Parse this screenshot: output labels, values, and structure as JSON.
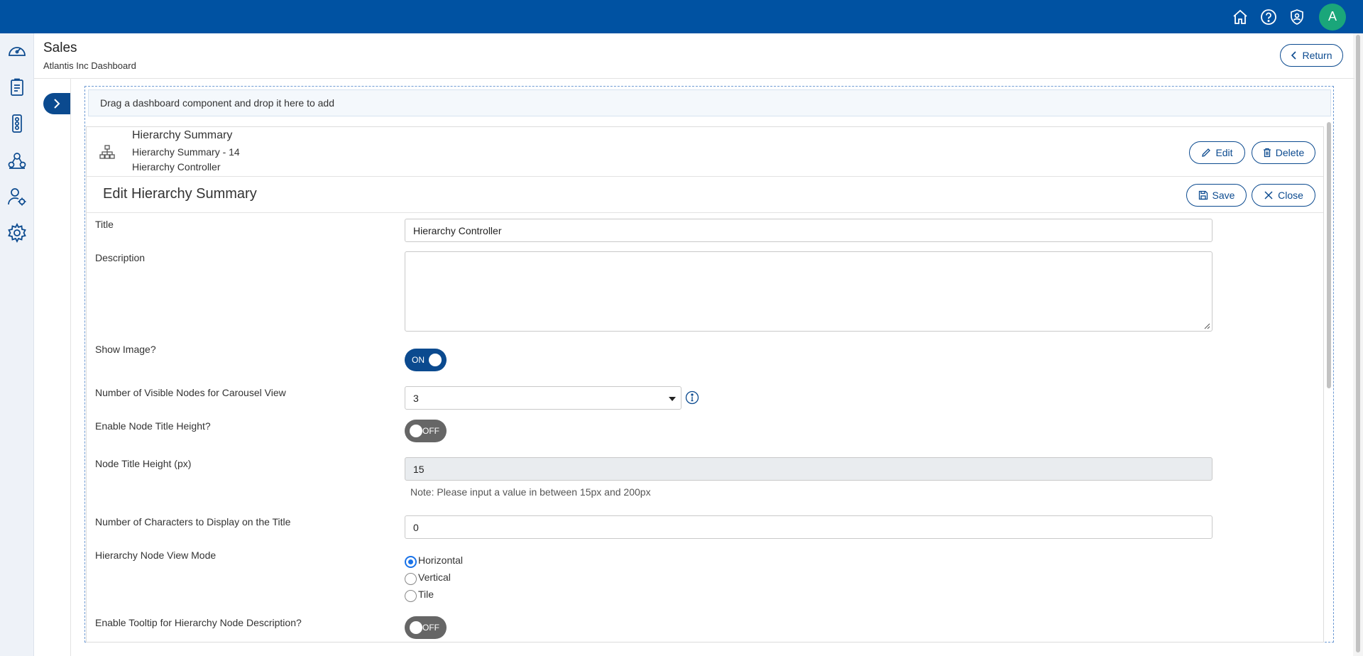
{
  "header": {
    "avatar_initial": "A",
    "icons": [
      "home-icon",
      "help-icon",
      "user-shield-icon"
    ]
  },
  "nav": {
    "icons": [
      "dashboard-gauge-icon",
      "document-icon",
      "traffic-light-icon",
      "network-icon",
      "user-settings-icon",
      "gear-icon"
    ]
  },
  "page": {
    "title": "Sales",
    "subtitle": "Atlantis Inc Dashboard",
    "return_label": "Return"
  },
  "dropzone": {
    "hint": "Drag a dashboard component and drop it here to add"
  },
  "component": {
    "name": "Hierarchy Summary",
    "id_label": "Hierarchy Summary - 14",
    "title": "Hierarchy Controller",
    "edit_label": "Edit",
    "delete_label": "Delete"
  },
  "editor": {
    "heading": "Edit Hierarchy Summary",
    "save_label": "Save",
    "close_label": "Close",
    "fields": {
      "title": {
        "label": "Title",
        "value": "Hierarchy Controller"
      },
      "description": {
        "label": "Description",
        "value": ""
      },
      "show_image": {
        "label": "Show Image?",
        "state": "ON"
      },
      "visible_nodes": {
        "label": "Number of Visible Nodes for Carousel View",
        "value": "3"
      },
      "enable_title_height": {
        "label": "Enable Node Title Height?",
        "state": "OFF"
      },
      "title_height": {
        "label": "Node Title Height (px)",
        "value": "15",
        "note": "Note: Please input a value in between 15px and 200px"
      },
      "title_chars": {
        "label": "Number of Characters to Display on the Title",
        "value": "0"
      },
      "view_mode": {
        "label": "Hierarchy Node View Mode",
        "options": [
          "Horizontal",
          "Vertical",
          "Tile"
        ],
        "selected": "Horizontal"
      },
      "tooltip": {
        "label": "Enable Tooltip for Hierarchy Node Description?",
        "state": "OFF"
      }
    }
  }
}
